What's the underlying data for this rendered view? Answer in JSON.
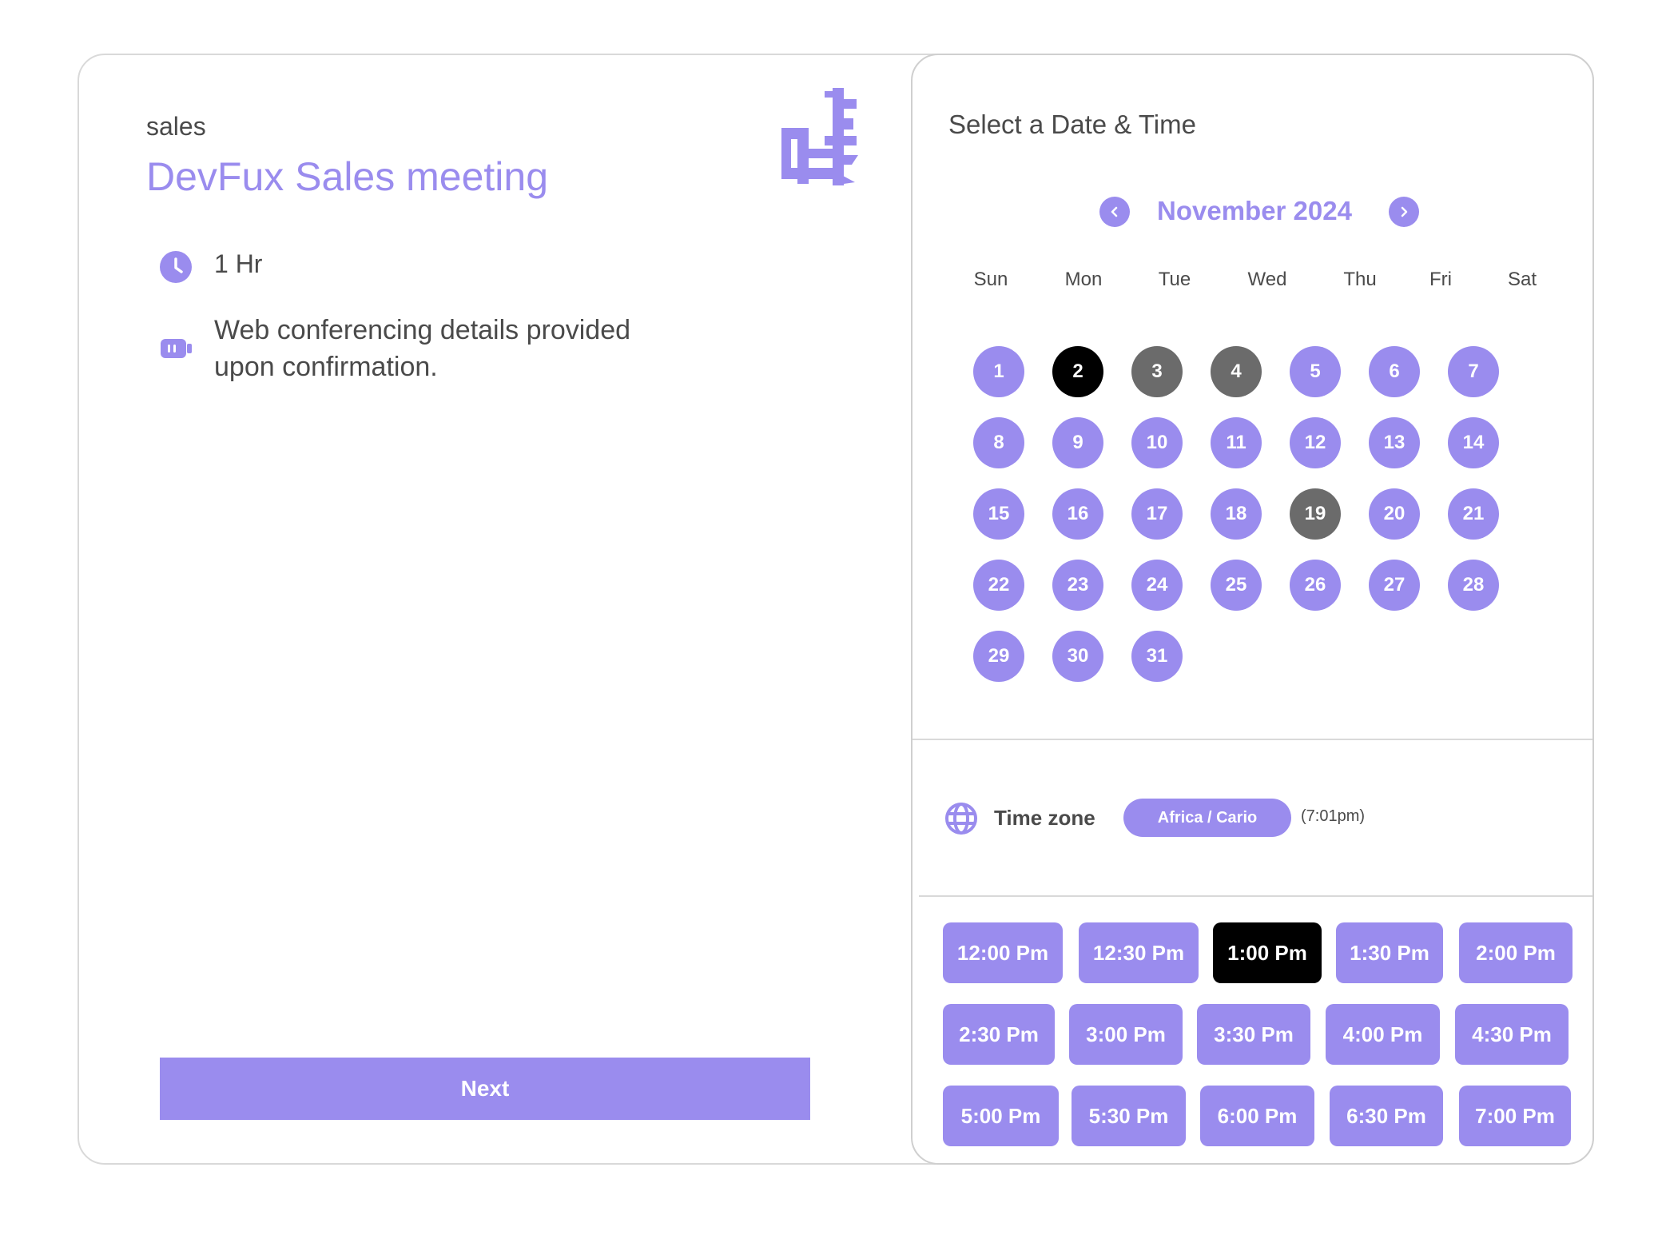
{
  "event": {
    "category": "sales",
    "title": "DevFux Sales meeting",
    "duration": "1 Hr",
    "conferencing": "Web conferencing details provided upon confirmation."
  },
  "next_label": "Next",
  "calendar": {
    "heading": "Select a Date & Time",
    "month_label": "November 2024",
    "weekdays": [
      "Sun",
      "Mon",
      "Tue",
      "Wed",
      "Thu",
      "Fri",
      "Sat"
    ],
    "days": [
      "1",
      "2",
      "3",
      "4",
      "5",
      "6",
      "7",
      "8",
      "9",
      "10",
      "11",
      "12",
      "13",
      "14",
      "15",
      "16",
      "17",
      "18",
      "19",
      "20",
      "21",
      "22",
      "23",
      "24",
      "25",
      "26",
      "27",
      "28",
      "29",
      "30",
      "31"
    ],
    "selected_day": "2",
    "unavailable_days": [
      "3",
      "4",
      "19"
    ]
  },
  "timezone": {
    "label": "Time zone",
    "value": "Africa / Cario",
    "current_time": "(7:01pm)"
  },
  "time_slots": {
    "rows": [
      [
        "12:00 Pm",
        "12:30 Pm",
        "1:00 Pm",
        "1:30 Pm",
        "2:00 Pm"
      ],
      [
        "2:30 Pm",
        "3:00 Pm",
        "3:30 Pm",
        "4:00 Pm",
        "4:30 Pm"
      ],
      [
        "5:00 Pm",
        "5:30 Pm",
        "6:00 Pm",
        "6:30 Pm",
        "7:00 Pm"
      ]
    ],
    "selected": "1:00 Pm"
  },
  "colors": {
    "accent": "#9a8cee",
    "selected": "#000000",
    "unavailable": "#6b6b6b",
    "text": "#4a4a4a"
  },
  "icons": {
    "duration": "clock-icon",
    "conferencing": "video-icon",
    "timezone": "globe-icon",
    "prev": "chevron-left-icon",
    "next": "chevron-right-icon",
    "brand": "devfux-logo"
  }
}
